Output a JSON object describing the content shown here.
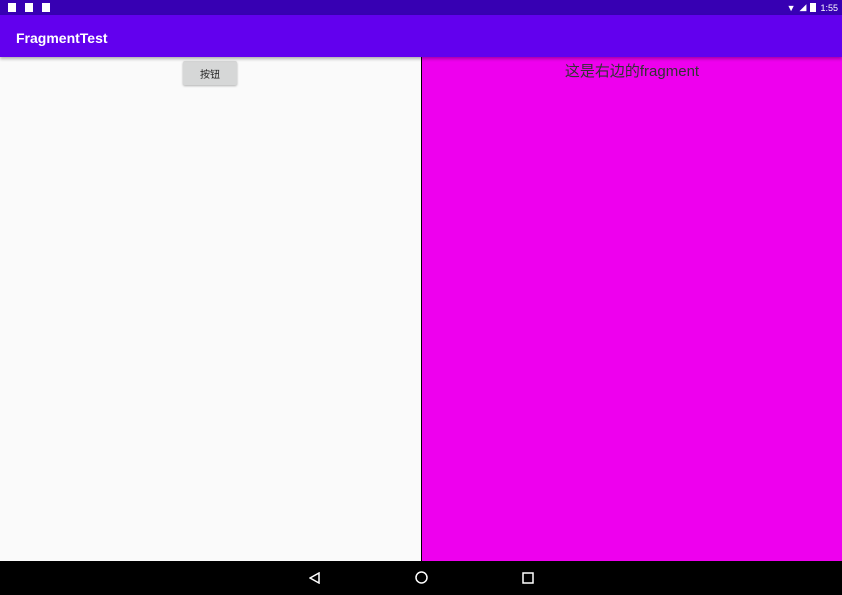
{
  "status_bar": {
    "time": "1:55"
  },
  "app_bar": {
    "title": "FragmentTest"
  },
  "left_fragment": {
    "button_label": "按钮"
  },
  "right_fragment": {
    "text": "这是右边的fragment"
  },
  "colors": {
    "primary": "#6200ee",
    "primary_dark": "#3700b3",
    "right_bg": "#ee00ee"
  }
}
